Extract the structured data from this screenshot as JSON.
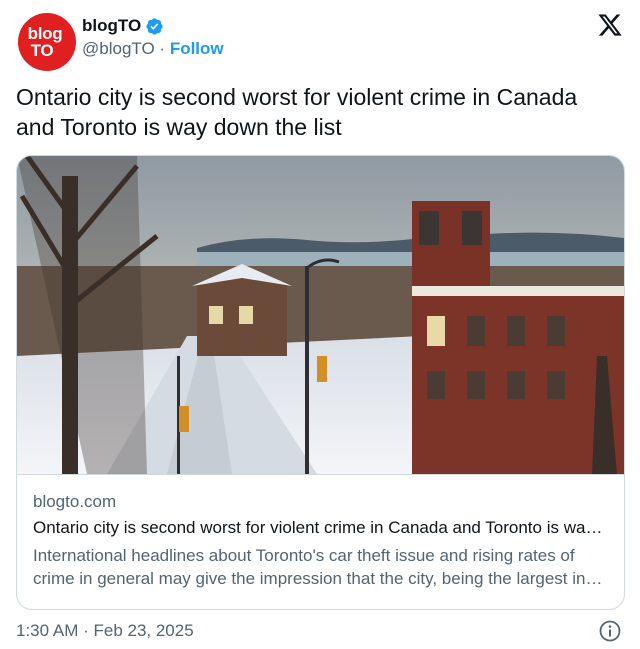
{
  "author": {
    "avatar_line1": "blog",
    "avatar_line2": "TO",
    "display_name": "blogTO",
    "handle": "@blogTO",
    "separator": " · ",
    "follow_label": "Follow"
  },
  "tweet": {
    "text": "Ontario city is second worst for violent crime in Canada and Toronto is way down the list"
  },
  "card": {
    "domain": "blogto.com",
    "title": "Ontario city is second worst for violent crime in Canada and Toronto is way down the list",
    "description": "International headlines about Toronto's car theft issue and rising rates of crime in general may give the impression that the city, being the largest in the country, is a hotbed of violent crime."
  },
  "footer": {
    "timestamp": "1:30 AM · Feb 23, 2025"
  },
  "icons": {
    "verified": "verified-badge-icon",
    "platform": "x-logo-icon",
    "info": "info-icon"
  },
  "colors": {
    "accent": "#1d9bf0",
    "avatar_bg": "#e02020",
    "secondary_text": "#536471",
    "border": "#cfd9de"
  }
}
